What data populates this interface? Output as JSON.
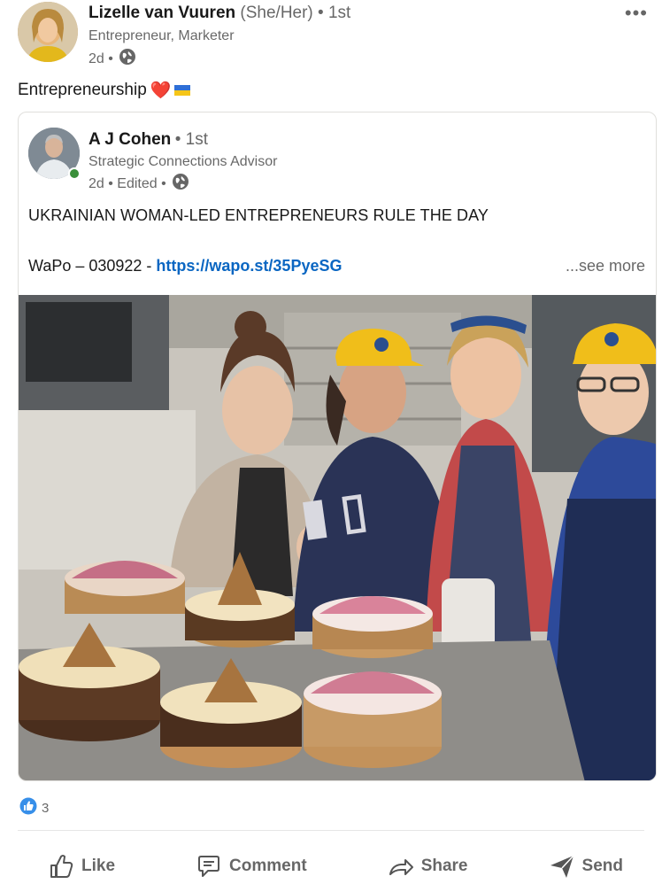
{
  "author": {
    "name": "Lizelle van Vuuren",
    "pronouns": "(She/Her)",
    "degree": "• 1st",
    "headline": "Entrepreneur, Marketer",
    "time": "2d •"
  },
  "post": {
    "text": "Entrepreneurship",
    "emoji_heart": "❤️"
  },
  "shared": {
    "author_name": "A J Cohen",
    "degree": "• 1st",
    "headline": "Strategic Connections Advisor",
    "time": "2d • Edited •",
    "title": "UKRAINIAN WOMAN-LED ENTREPRENEURS RULE THE DAY",
    "link_prefix": "WaPo – 030922 - ",
    "link_text": "https://wapo.st/35PyeSG",
    "see_more": "...see more"
  },
  "reactions": {
    "count": "3"
  },
  "actions": {
    "like": "Like",
    "comment": "Comment",
    "share": "Share",
    "send": "Send"
  },
  "icons": {
    "overflow": "more-horizontal-icon",
    "visibility": "globe-icon",
    "reaction": "like-reaction-icon"
  },
  "colors": {
    "link": "#0a66c2",
    "online": "#3a8f3a",
    "flag_blue": "#2f6fd6",
    "flag_yellow": "#f5c518"
  }
}
